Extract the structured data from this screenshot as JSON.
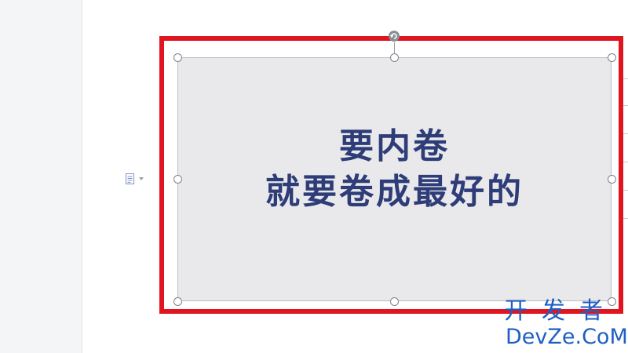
{
  "document": {
    "image_text_line1": "要内卷",
    "image_text_line2": "就要卷成最好的"
  },
  "watermark": {
    "line1": "开发者",
    "line2": "DevZe.CoM"
  },
  "colors": {
    "highlight_frame": "#e0151f",
    "headline_text": "#2e3c78",
    "image_background": "#e9e9eb",
    "watermark": "#1f5fc4"
  },
  "icons": {
    "paragraph_marker": "paragraph-layout-icon",
    "rotate": "rotate-handle-icon"
  }
}
